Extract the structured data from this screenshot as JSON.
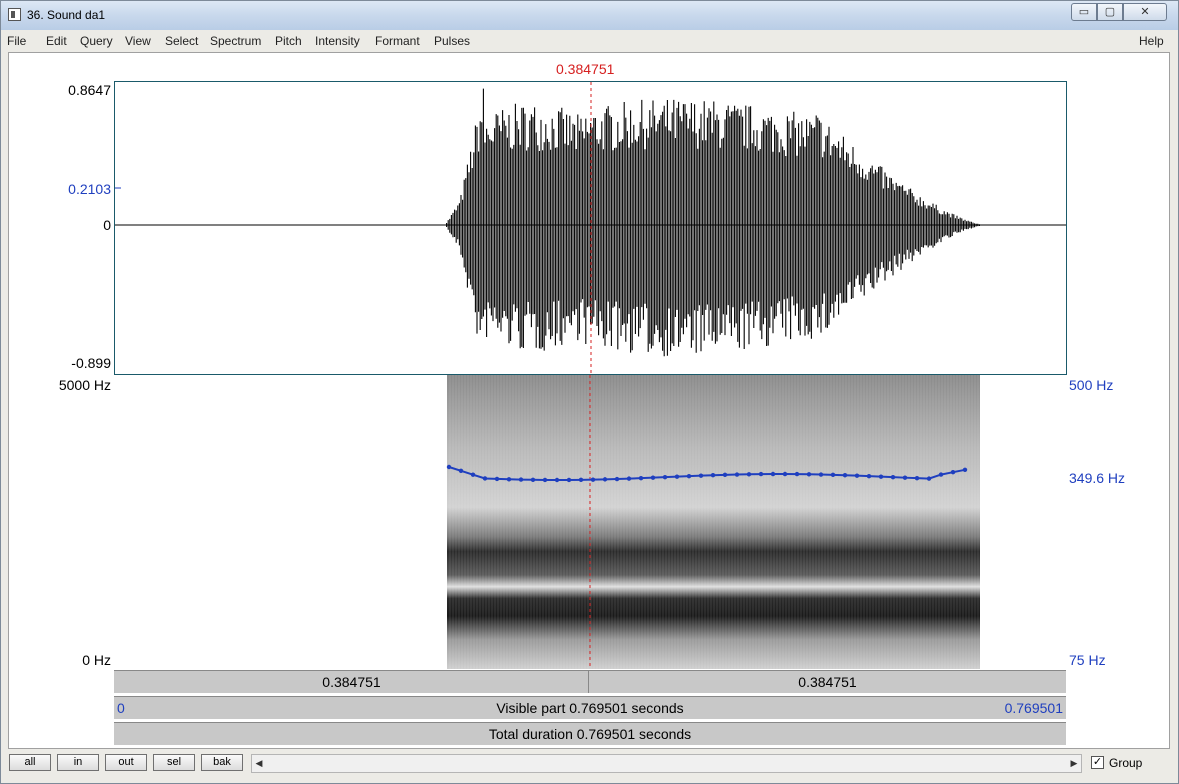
{
  "window": {
    "title": "36. Sound da1",
    "min_label": "▭",
    "max_label": "▢",
    "close_label": "✕"
  },
  "menu": [
    {
      "label": "File"
    },
    {
      "label": "Edit"
    },
    {
      "label": "Query"
    },
    {
      "label": "View"
    },
    {
      "label": "Select"
    },
    {
      "label": "Spectrum"
    },
    {
      "label": "Pitch"
    },
    {
      "label": "Intensity"
    },
    {
      "label": "Formant"
    },
    {
      "label": "Pulses"
    },
    {
      "label": "Help"
    }
  ],
  "cursor": {
    "time": "0.384751",
    "color": "#d62020"
  },
  "waveform": {
    "max": "0.8647",
    "mark": "0.2103",
    "zero": "0",
    "min": "-0.899"
  },
  "spectrogram": {
    "top": "5000 Hz",
    "bottom": "0 Hz"
  },
  "pitch": {
    "top": "500 Hz",
    "value": "349.6 Hz",
    "bottom": "75 Hz",
    "color": "#1f3fbf"
  },
  "time_bars": {
    "left_segment": "0.384751",
    "right_segment": "0.384751",
    "visible_start": "0",
    "visible_label": "Visible part 0.769501 seconds",
    "visible_end": "0.769501",
    "total_label": "Total duration 0.769501 seconds"
  },
  "zoom": [
    {
      "label": "all"
    },
    {
      "label": "in"
    },
    {
      "label": "out"
    },
    {
      "label": "sel"
    },
    {
      "label": "bak"
    }
  ],
  "scroll": {
    "left_arrow": "◀",
    "right_arrow": "▶"
  },
  "group": {
    "label": "Group",
    "checked": true,
    "mark": "✓"
  }
}
